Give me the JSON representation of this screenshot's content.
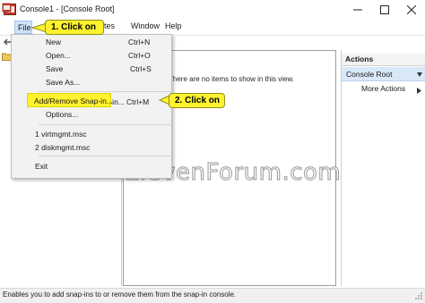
{
  "window": {
    "title": "Console1 - [Console Root]"
  },
  "menubar": {
    "file": "File",
    "favorites": "rites",
    "window": "Window",
    "help": "Help"
  },
  "file_menu": {
    "items": [
      {
        "label": "New",
        "shortcut": "Ctrl+N"
      },
      {
        "label": "Open...",
        "shortcut": "Ctrl+O"
      },
      {
        "label": "Save",
        "shortcut": "Ctrl+S"
      },
      {
        "label": "Save As...",
        "shortcut": ""
      },
      {
        "label": "Add/Remove Snap-in...",
        "shortcut": "Ctrl+M"
      },
      {
        "label": "Options...",
        "shortcut": ""
      },
      {
        "label": "1 virtmgmt.msc",
        "shortcut": ""
      },
      {
        "label": "2 diskmgmt.msc",
        "shortcut": ""
      },
      {
        "label": "Exit",
        "shortcut": ""
      }
    ]
  },
  "callouts": {
    "step1": "1. Click on",
    "step2": "2. Click on"
  },
  "center": {
    "empty_message": "There are no items to show in this view."
  },
  "actions": {
    "header": "Actions",
    "group": "Console Root",
    "more": "More Actions"
  },
  "watermark": "ElevenForum.com",
  "status": {
    "text": "Enables you to add snap-ins to or remove them from the snap-in console."
  },
  "icons": {
    "app": "mmc-console-icon",
    "minimize": "minimize-icon",
    "maximize": "maximize-icon",
    "close": "close-icon",
    "back": "back-arrow-icon",
    "folder": "folder-icon",
    "chevron": "chevron-right-icon"
  },
  "colors": {
    "highlight": "#fff22e",
    "selection": "#d9e8f7",
    "menu_bg": "#f2f2f2"
  }
}
